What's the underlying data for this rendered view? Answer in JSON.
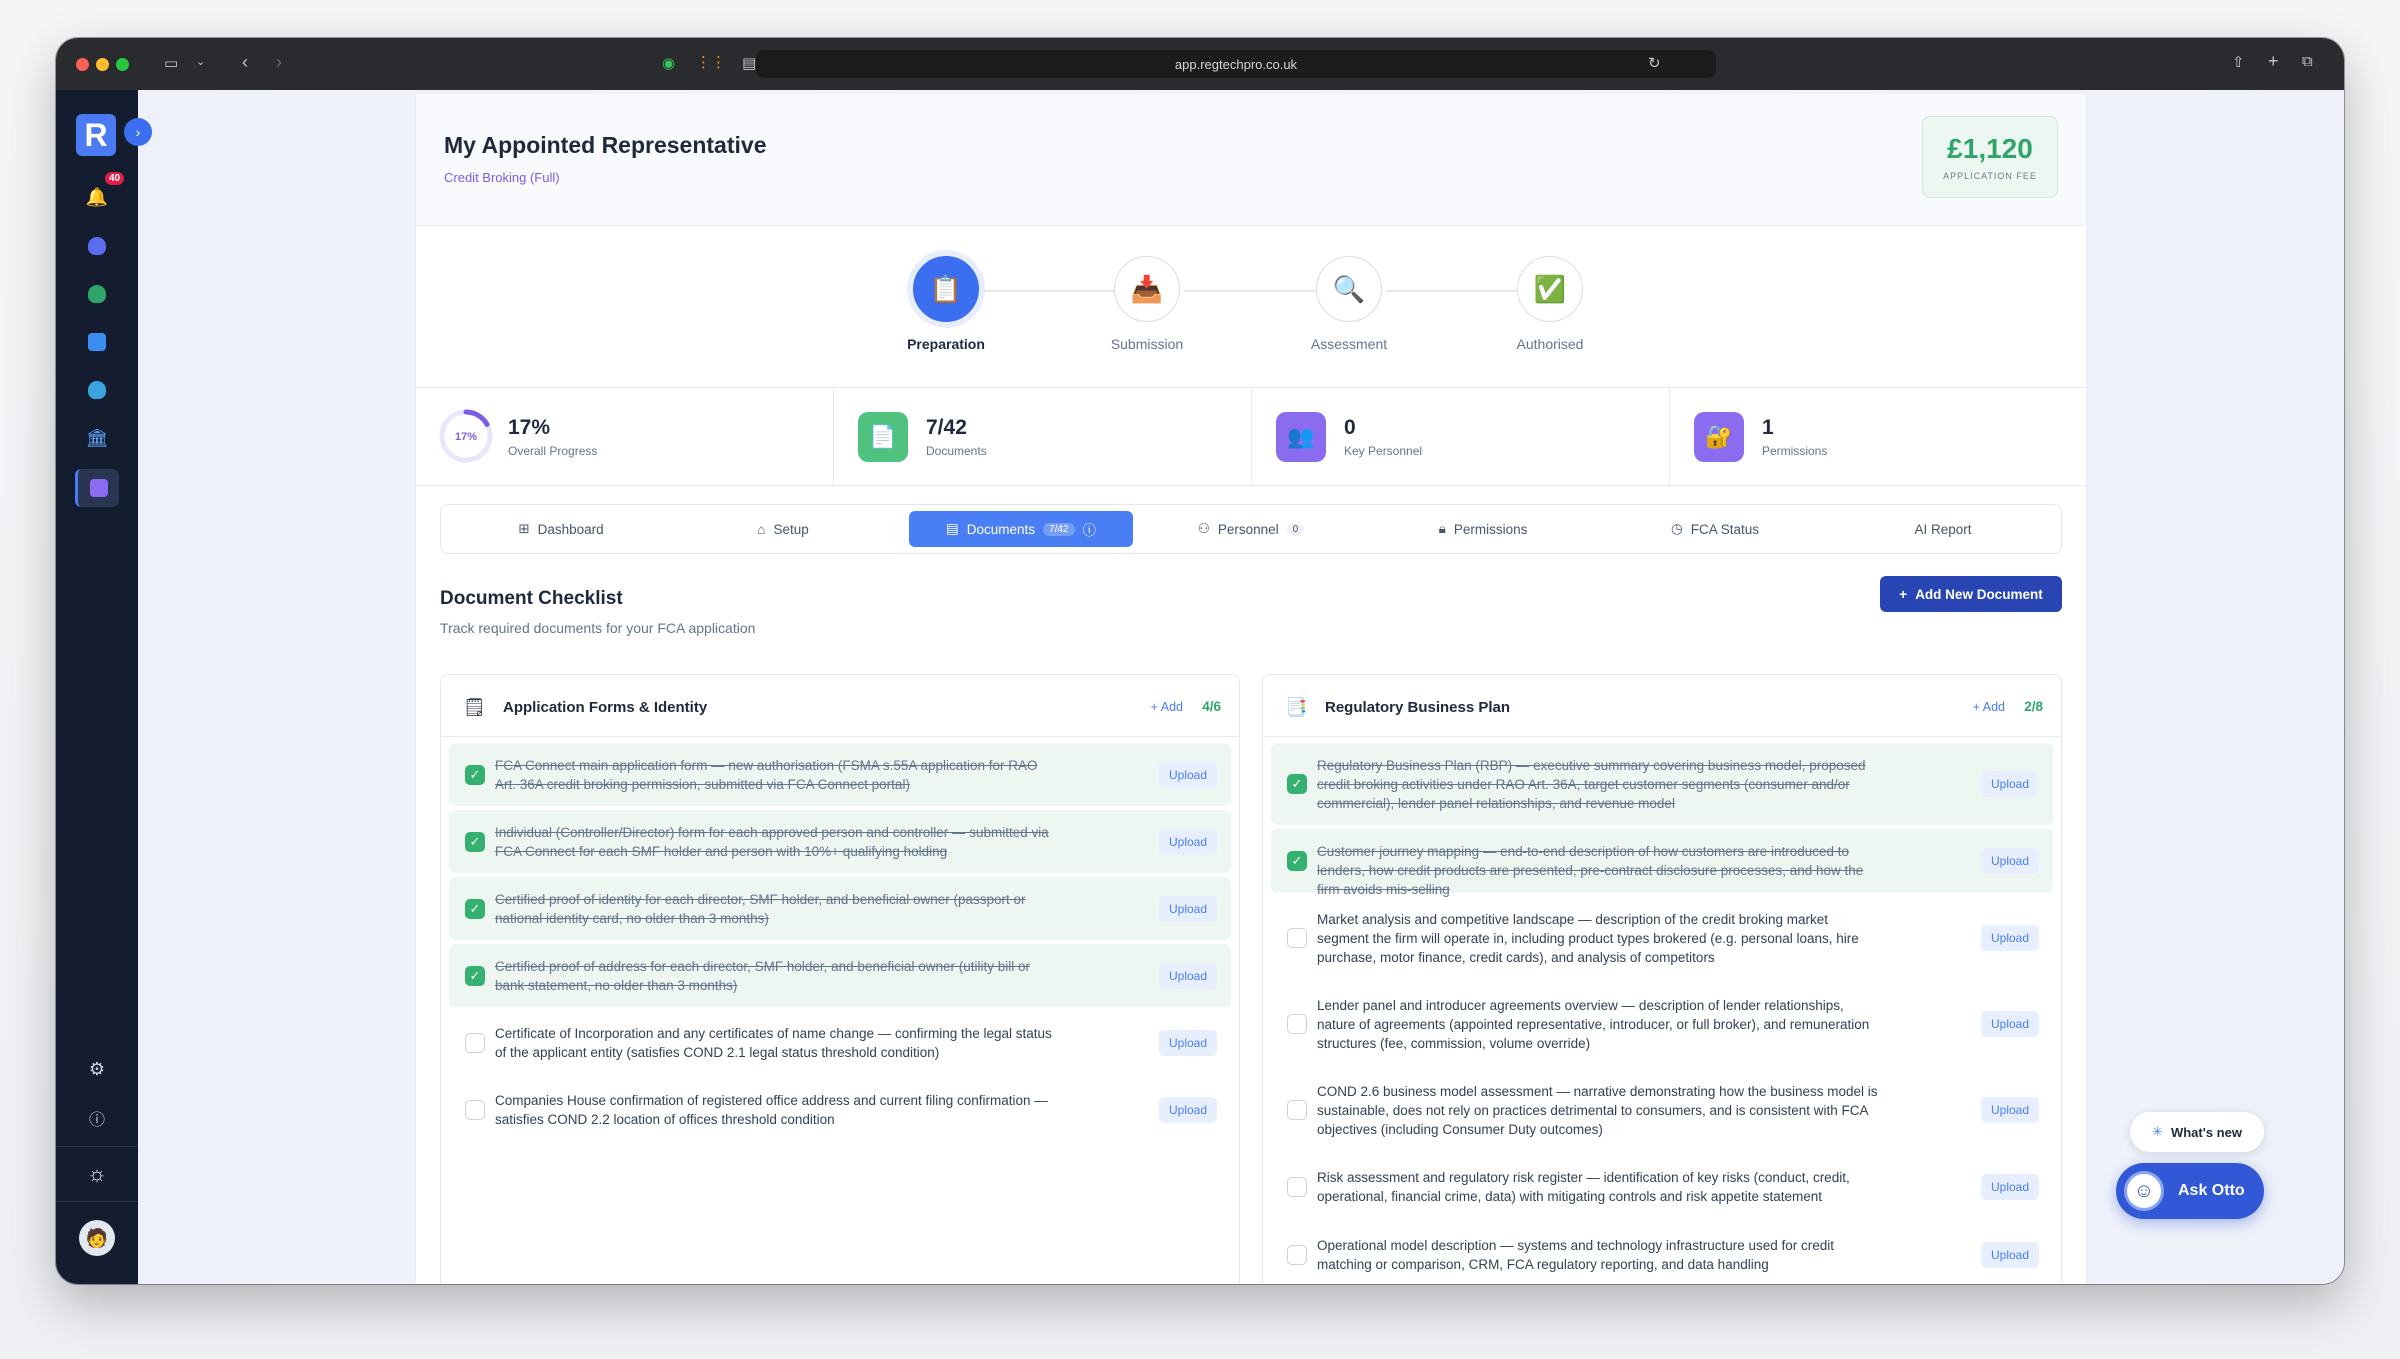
{
  "browser": {
    "url": "app.regtechpro.co.uk"
  },
  "sidebar": {
    "logo": "R",
    "notification_count": "40"
  },
  "header": {
    "title": "My Appointed Representative",
    "subtitle": "Credit Broking (Full)",
    "fee_value": "£1,120",
    "fee_label": "APPLICATION FEE"
  },
  "steps": [
    {
      "label": "Preparation",
      "icon": "clipboard-icon",
      "state": "active"
    },
    {
      "label": "Submission",
      "icon": "inbox-tray-icon",
      "state": "pending"
    },
    {
      "label": "Assessment",
      "icon": "magnifier-icon",
      "state": "pending"
    },
    {
      "label": "Authorised",
      "icon": "check-mark-icon",
      "state": "pending"
    }
  ],
  "stats": [
    {
      "value": "17%",
      "label": "Overall Progress",
      "ring_text": "17%",
      "progress": 0.17
    },
    {
      "value": "7/42",
      "label": "Documents",
      "icon": "document-icon"
    },
    {
      "value": "0",
      "label": "Key Personnel",
      "icon": "people-icon"
    },
    {
      "value": "1",
      "label": "Permissions",
      "icon": "lock-key-icon"
    }
  ],
  "tabs": [
    {
      "label": "Dashboard",
      "icon": "grid-icon"
    },
    {
      "label": "Setup",
      "icon": "briefcase-icon"
    },
    {
      "label": "Documents",
      "icon": "file-icon",
      "count": "7/42",
      "active": true
    },
    {
      "label": "Personnel",
      "icon": "users-icon",
      "count": "0"
    },
    {
      "label": "Permissions",
      "icon": "lock-icon"
    },
    {
      "label": "FCA Status",
      "icon": "clock-icon"
    },
    {
      "label": "AI Report"
    }
  ],
  "section": {
    "title": "Document Checklist",
    "subtitle": "Track required documents for your FCA application",
    "add_button": "Add New Document"
  },
  "panels": [
    {
      "title": "Application Forms & Identity",
      "add_label": "+ Add",
      "count": "4/6",
      "items": [
        {
          "text": "FCA Connect main application form — new authorisation (FSMA s.55A application for RAO Art. 36A credit broking permission, submitted via FCA Connect portal)",
          "done": true,
          "action": "Upload"
        },
        {
          "text": "Individual (Controller/Director) form for each approved person and controller — submitted via FCA Connect for each SMF holder and person with 10%+ qualifying holding",
          "done": true,
          "action": "Upload"
        },
        {
          "text": "Certified proof of identity for each director, SMF holder, and beneficial owner (passport or national identity card, no older than 3 months)",
          "done": true,
          "action": "Upload"
        },
        {
          "text": "Certified proof of address for each director, SMF holder, and beneficial owner (utility bill or bank statement, no older than 3 months)",
          "done": true,
          "action": "Upload"
        },
        {
          "text": "Certificate of Incorporation and any certificates of name change — confirming the legal status of the applicant entity (satisfies COND 2.1 legal status threshold condition)",
          "done": false,
          "action": "Upload"
        },
        {
          "text": "Companies House confirmation of registered office address and current filing confirmation — satisfies COND 2.2 location of offices threshold condition",
          "done": false,
          "action": "Upload"
        }
      ]
    },
    {
      "title": "Regulatory Business Plan",
      "add_label": "+ Add",
      "count": "2/8",
      "items": [
        {
          "text": "Regulatory Business Plan (RBP) — executive summary covering business model, proposed credit broking activities under RAO Art. 36A, target customer segments (consumer and/or commercial), lender panel relationships, and revenue model",
          "done": true,
          "action": "Upload"
        },
        {
          "text": "Customer journey mapping — end-to-end description of how customers are introduced to lenders, how credit products are presented, pre-contract disclosure processes, and how the firm avoids mis-selling",
          "done": true,
          "action": "Upload"
        },
        {
          "text": "Market analysis and competitive landscape — description of the credit broking market segment the firm will operate in, including product types brokered (e.g. personal loans, hire purchase, motor finance, credit cards), and analysis of competitors",
          "done": false,
          "action": "Upload"
        },
        {
          "text": "Lender panel and introducer agreements overview — description of lender relationships, nature of agreements (appointed representative, introducer, or full broker), and remuneration structures (fee, commission, volume override)",
          "done": false,
          "action": "Upload"
        },
        {
          "text": "COND 2.6 business model assessment — narrative demonstrating how the business model is sustainable, does not rely on practices detrimental to consumers, and is consistent with FCA objectives (including Consumer Duty outcomes)",
          "done": false,
          "action": "Upload"
        },
        {
          "text": "Risk assessment and regulatory risk register — identification of key risks (conduct, credit, operational, financial crime, data) with mitigating controls and risk appetite statement",
          "done": false,
          "action": "Upload"
        },
        {
          "text": "Operational model description — systems and technology infrastructure used for credit matching or comparison, CRM, FCA regulatory reporting, and data handling",
          "done": false,
          "action": "Upload"
        }
      ]
    }
  ],
  "floating": {
    "whats_new": "What's new",
    "ask_otto": "Ask Otto"
  }
}
